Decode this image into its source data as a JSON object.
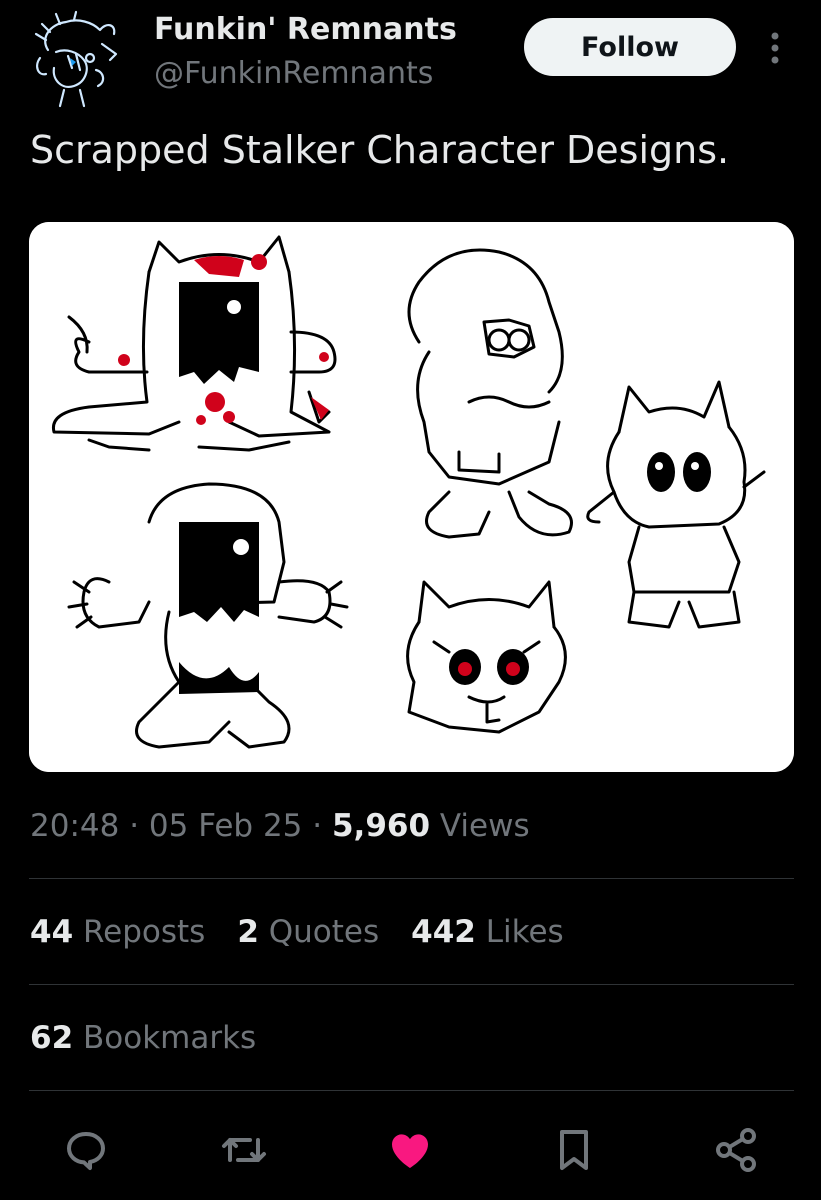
{
  "author": {
    "name": "Funkin' Remnants",
    "handle": "@FunkinRemnants",
    "avatar_icon": "sketch-character-avatar"
  },
  "follow_label": "Follow",
  "more_icon": "more-vertical-icon",
  "tweet": {
    "text": "Scrapped Stalker Character Designs."
  },
  "media": {
    "icon": "character-sketches-image"
  },
  "meta": {
    "time": "20:48",
    "sep1": " · ",
    "date": "05 Feb 25",
    "sep2": " · ",
    "views_count": "5,960",
    "views_label": " Views"
  },
  "stats": {
    "reposts_count": "44",
    "reposts_label": " Reposts",
    "quotes_count": "2",
    "quotes_label": " Quotes",
    "likes_count": "442",
    "likes_label": " Likes",
    "bookmarks_count": "62",
    "bookmarks_label": " Bookmarks"
  },
  "actions": [
    {
      "icon": "reply-icon"
    },
    {
      "icon": "repost-icon"
    },
    {
      "icon": "like-icon",
      "color": "#f91880",
      "active": true
    },
    {
      "icon": "bookmark-icon"
    },
    {
      "icon": "share-icon"
    }
  ],
  "colors": {
    "background": "#000000",
    "text_primary": "#e7e9ea",
    "text_secondary": "#71767b",
    "divider": "#2f3336",
    "like_active": "#f91880",
    "follow_bg": "#eff3f4"
  }
}
